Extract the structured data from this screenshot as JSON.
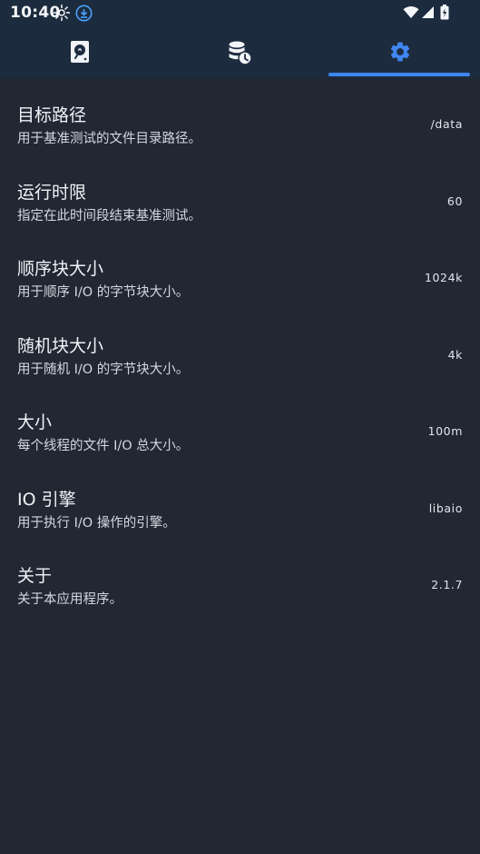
{
  "status_bar": {
    "time": "10:40",
    "icons": [
      "weather-burst-icon",
      "download-icon",
      "wifi-icon",
      "signal-icon",
      "battery-charging-icon"
    ]
  },
  "tabs": [
    {
      "name": "disk-icon",
      "active": false
    },
    {
      "name": "database-history-icon",
      "active": false
    },
    {
      "name": "settings-gear-icon",
      "active": true
    }
  ],
  "colors": {
    "background": "#212834",
    "top_bar": "#1d2b3f",
    "accent": "#3f86f0"
  },
  "settings": [
    {
      "title": "目标路径",
      "subtitle": "用于基准测试的文件目录路径。",
      "value": "/data"
    },
    {
      "title": "运行时限",
      "subtitle": "指定在此时间段结束基准测试。",
      "value": "60"
    },
    {
      "title": "顺序块大小",
      "subtitle": "用于顺序 I/O 的字节块大小。",
      "value": "1024k"
    },
    {
      "title": "随机块大小",
      "subtitle": "用于随机 I/O 的字节块大小。",
      "value": "4k"
    },
    {
      "title": "大小",
      "subtitle": "每个线程的文件 I/O 总大小。",
      "value": "100m"
    },
    {
      "title": "IO 引擎",
      "subtitle": "用于执行 I/O 操作的引擎。",
      "value": "libaio"
    },
    {
      "title": "关于",
      "subtitle": "关于本应用程序。",
      "value": "2.1.7"
    }
  ]
}
